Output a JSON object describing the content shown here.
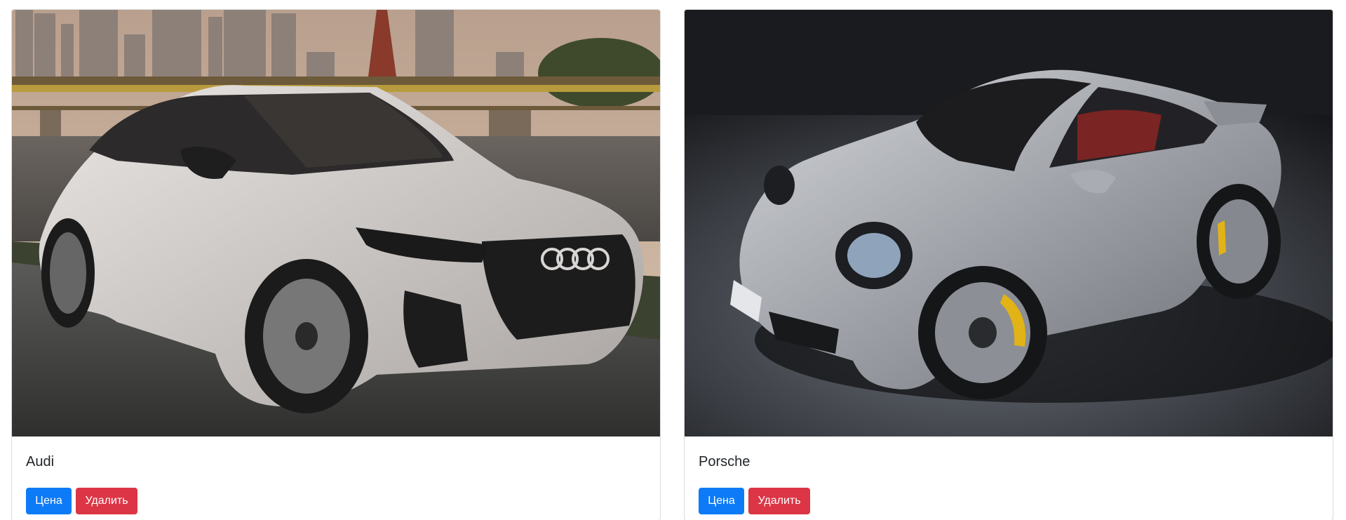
{
  "cards": [
    {
      "title": "Audi",
      "image_subject": "audi-rs7-sportback-silver",
      "price_button": "Цена",
      "delete_button": "Удалить"
    },
    {
      "title": "Porsche",
      "image_subject": "porsche-911-turbo-silver",
      "price_button": "Цена",
      "delete_button": "Удалить"
    }
  ],
  "colors": {
    "primary": "#0d7bf7",
    "danger": "#dc3545",
    "card_border": "#dcdcdc",
    "text": "#212529"
  }
}
